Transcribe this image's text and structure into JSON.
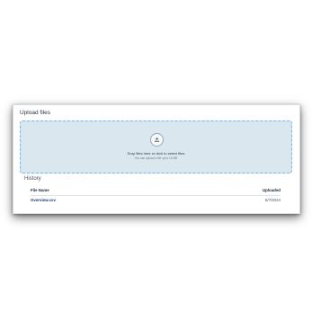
{
  "upload": {
    "title": "Upload files",
    "dropzone": {
      "icon": "upload-icon",
      "primary_text": "Drop files here or click to select files",
      "secondary_text": "You can upload a file up to 10 MB"
    }
  },
  "history": {
    "title": "History",
    "columns": {
      "file_name": "File Name",
      "uploaded": "Uploaded"
    },
    "rows": [
      {
        "file_name": "Overview.csv",
        "uploaded": "6/7/2024"
      }
    ]
  },
  "colors": {
    "dropzone_bg": "#dbe7ef",
    "dropzone_border": "#7fb8e6",
    "link": "#1d3b6e"
  }
}
